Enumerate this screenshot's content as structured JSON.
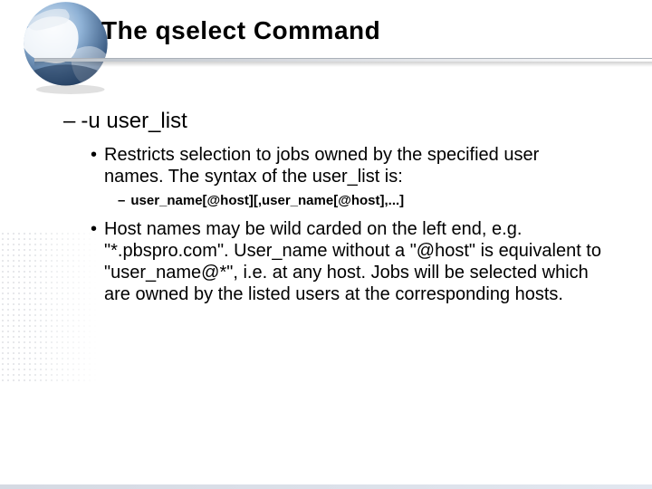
{
  "title": "The qselect Command",
  "icon_name": "globe-icon",
  "bullets": {
    "option_flag": "-u user_list",
    "restricts_text": "Restricts selection to jobs owned by the specified user names. The syntax of the user_list is:",
    "syntax_line": "user_name[@host][,user_name[@host],...]",
    "hostnames_text": "Host names may be wild carded on the left end, e.g. \"*.pbspro.com\". User_name without a \"@host\" is equivalent to \"user_name@*\", i.e. at any host. Jobs will be selected which are owned by the listed users at the corresponding hosts."
  },
  "markers": {
    "dash": "–",
    "dot": "•"
  }
}
